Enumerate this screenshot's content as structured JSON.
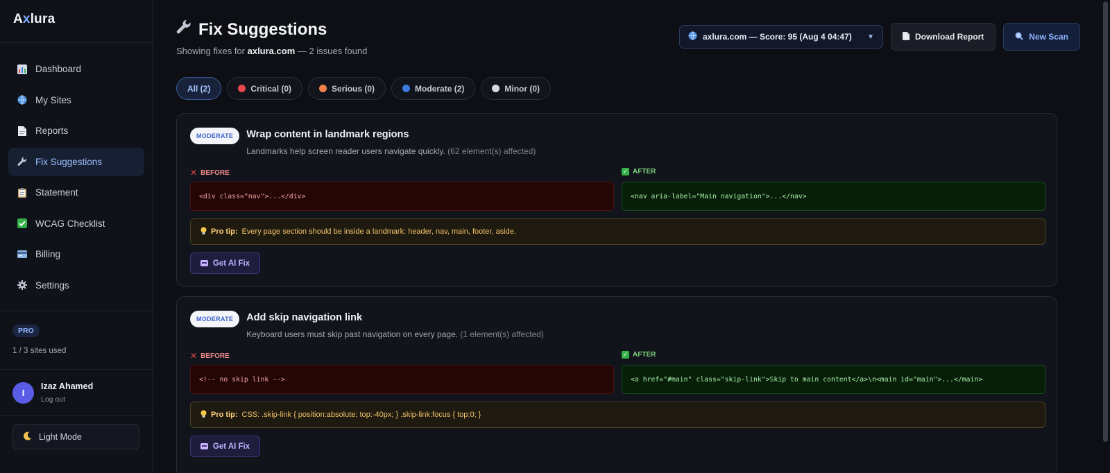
{
  "brand": {
    "prefix": "A",
    "x": "x",
    "suffix": "lura"
  },
  "sidebar": {
    "items": [
      {
        "label": "Dashboard",
        "icon": "chart-icon"
      },
      {
        "label": "My Sites",
        "icon": "globe-icon"
      },
      {
        "label": "Reports",
        "icon": "document-icon"
      },
      {
        "label": "Fix Suggestions",
        "icon": "wrench-icon",
        "active": true
      },
      {
        "label": "Statement",
        "icon": "clipboard-icon"
      },
      {
        "label": "WCAG Checklist",
        "icon": "checkbox-icon"
      },
      {
        "label": "Billing",
        "icon": "card-icon"
      },
      {
        "label": "Settings",
        "icon": "gear-icon"
      }
    ],
    "plan_badge": "PRO",
    "plan_usage": "1 / 3 sites used",
    "user": {
      "initial": "I",
      "name": "Izaz Ahamed",
      "logout": "Log out"
    },
    "theme_toggle": "Light Mode"
  },
  "header": {
    "title": "Fix Suggestions",
    "subtitle_prefix": "Showing fixes for ",
    "subtitle_site": "axlura.com",
    "subtitle_suffix": " — 2 issues found",
    "site_select": "axlura.com — Score: 95 (Aug 4 04:47)",
    "download_label": "Download Report",
    "new_scan_label": "New Scan"
  },
  "filters": [
    {
      "label": "All (2)",
      "color": null,
      "active": true
    },
    {
      "label": "Critical (0)",
      "color": "#e5484d"
    },
    {
      "label": "Serious (0)",
      "color": "#f2804a"
    },
    {
      "label": "Moderate (2)",
      "color": "#3d7ae0"
    },
    {
      "label": "Minor (0)",
      "color": "#d9d9e6"
    }
  ],
  "labels": {
    "before": "BEFORE",
    "after": "AFTER",
    "pro_tip": "Pro tip:",
    "ai_fix": "Get AI Fix"
  },
  "issues": [
    {
      "severity": "MODERATE",
      "title": "Wrap content in landmark regions",
      "description": "Landmarks help screen reader users navigate quickly.",
      "affected": "(62 element(s) affected)",
      "before": "<div class=\"nav\">...</div>",
      "after": "<nav aria-label=\"Main navigation\">...</nav>",
      "tip": "Every page section should be inside a landmark: header, nav, main, footer, aside."
    },
    {
      "severity": "MODERATE",
      "title": "Add skip navigation link",
      "description": "Keyboard users must skip past navigation on every page.",
      "affected": "(1 element(s) affected)",
      "before": "<!-- no skip link -->",
      "after": "<a href=\"#main\" class=\"skip-link\">Skip to main content</a>\\n<main id=\"main\">...</main>",
      "tip": "CSS: .skip-link { position:absolute; top:-40px; } .skip-link:focus { top:0; }"
    }
  ],
  "colors": {
    "accent": "#8fb5ff",
    "background": "#0d0f15",
    "card": "#12141b"
  }
}
